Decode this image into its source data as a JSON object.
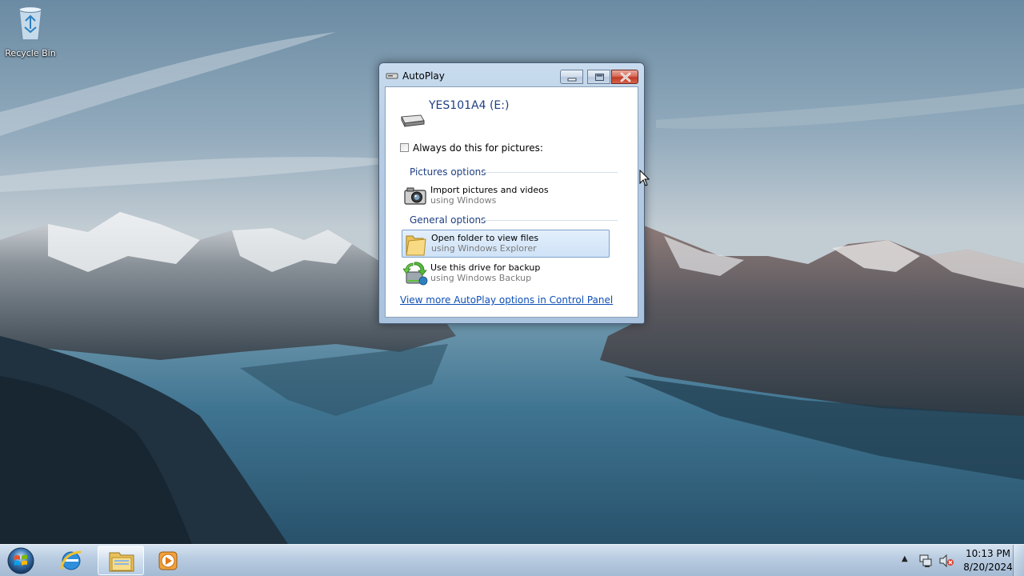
{
  "desktop": {
    "icons": [
      {
        "label": "Recycle Bin",
        "icon": "recycle-bin-icon"
      }
    ]
  },
  "window": {
    "title": "AutoPlay",
    "device_label": "YES101A4 (E:)",
    "always_do_label": "Always do this for pictures:",
    "always_do_checked": false,
    "sections": [
      {
        "heading": "Pictures options",
        "options": [
          {
            "title": "Import pictures and videos",
            "subtitle": "using Windows",
            "icon": "camera-icon"
          }
        ]
      },
      {
        "heading": "General options",
        "options": [
          {
            "title": "Open folder to view files",
            "subtitle": "using Windows Explorer",
            "icon": "folder-icon",
            "highlighted": true
          },
          {
            "title": "Use this drive for backup",
            "subtitle": "using Windows Backup",
            "icon": "backup-icon"
          }
        ]
      }
    ],
    "control_panel_link": "View more AutoPlay options in Control Panel"
  },
  "taskbar": {
    "start": "start-orb-icon",
    "pinned": [
      {
        "icon": "internet-explorer-icon",
        "active": false
      },
      {
        "icon": "windows-explorer-icon",
        "active": true
      },
      {
        "icon": "media-player-icon",
        "active": false
      }
    ],
    "tray": {
      "time": "10:13 PM",
      "date": "8/20/2024",
      "icons": [
        "show-hidden-icons-icon",
        "network-icon",
        "volume-muted-icon"
      ]
    }
  },
  "colors": {
    "link": "#0d4fb8",
    "heading": "#1e3f83",
    "close_button": "#c13c27"
  }
}
